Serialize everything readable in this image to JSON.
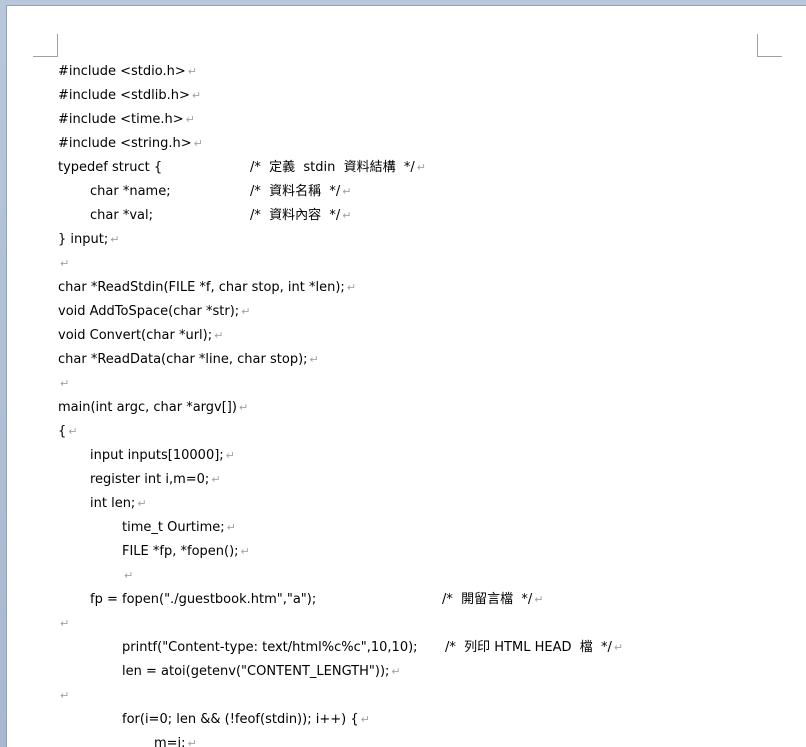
{
  "document": {
    "paragraph_mark": "↵",
    "lines": [
      {
        "code": "#include <stdio.h>",
        "indent": 0
      },
      {
        "code": "#include <stdlib.h>",
        "indent": 0
      },
      {
        "code": "#include <time.h>",
        "indent": 0
      },
      {
        "code": "#include <string.h>",
        "indent": 0
      },
      {
        "code": "typedef struct {",
        "indent": 0,
        "comment": "/*  定義  stdin  資料結構  */"
      },
      {
        "code": "char *name;",
        "indent": 1,
        "comment": "/*  資料名稱  */"
      },
      {
        "code": "char *val;",
        "indent": 1,
        "comment": "/*  資料內容  */"
      },
      {
        "code": "} input;",
        "indent": 0
      },
      {
        "code": "",
        "indent": 0
      },
      {
        "code": "char *ReadStdin(FILE *f, char stop, int *len);",
        "indent": 0
      },
      {
        "code": "void AddToSpace(char *str);",
        "indent": 0
      },
      {
        "code": "void Convert(char *url);",
        "indent": 0
      },
      {
        "code": "char *ReadData(char *line, char stop);",
        "indent": 0
      },
      {
        "code": "",
        "indent": 0
      },
      {
        "code": "main(int argc, char *argv[])",
        "indent": 0
      },
      {
        "code": "{",
        "indent": 0
      },
      {
        "code": "input inputs[10000];",
        "indent": 1
      },
      {
        "code": "register int i,m=0;",
        "indent": 1
      },
      {
        "code": "int len;",
        "indent": 1
      },
      {
        "code": "time_t Ourtime;",
        "indent": 2
      },
      {
        "code": "FILE *fp, *fopen();",
        "indent": 2
      },
      {
        "code": "",
        "indent": 2
      },
      {
        "code": "fp = fopen(\"./guestbook.htm\",\"a\");",
        "indent": 1,
        "comment": "/*  開留言檔  */"
      },
      {
        "code": "",
        "indent": 0
      },
      {
        "code": "printf(\"Content-type: text/html%c%c\",10,10);",
        "indent": 2,
        "comment": "/*  列印 HTML HEAD  檔  */"
      },
      {
        "code": "len = atoi(getenv(\"CONTENT_LENGTH\"));",
        "indent": 2
      },
      {
        "code": "",
        "indent": 0
      },
      {
        "code": "for(i=0; len && (!feof(stdin)); i++) {",
        "indent": 2
      },
      {
        "code": "m=i;",
        "indent": 3
      }
    ]
  }
}
